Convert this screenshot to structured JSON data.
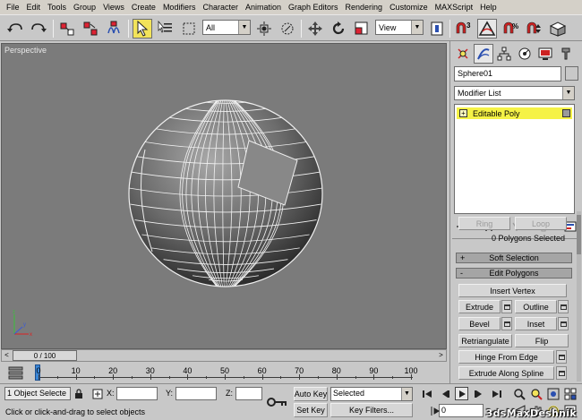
{
  "menu": [
    "File",
    "Edit",
    "Tools",
    "Group",
    "Views",
    "Create",
    "Modifiers",
    "Character",
    "Animation",
    "Graph Editors",
    "Rendering",
    "Customize",
    "MAXScript",
    "Help"
  ],
  "toolbar": {
    "selection_filter": "All",
    "reference_coord": "View",
    "icons": [
      "undo-icon",
      "redo-icon",
      "select-and-link-icon",
      "unlink-icon",
      "bind-space-warp-icon",
      "select-object-icon",
      "select-by-name-icon",
      "rectangular-selection-icon",
      "window-crossing-icon",
      "select-and-move-icon",
      "select-and-rotate-icon",
      "select-and-scale-icon",
      "use-pivot-center-icon",
      "select-and-manipulate-icon",
      "snaps-toggle-icon",
      "angle-snap-icon",
      "percent-snap-icon",
      "spinner-snap-icon",
      "named-selection-icon"
    ]
  },
  "viewport": {
    "label": "Perspective",
    "background": "#7b7b7b",
    "axes": {
      "x": "x",
      "y": "y",
      "z": "z"
    }
  },
  "timeslider": {
    "label": "0 / 100",
    "current_frame": 0,
    "total_frames": 100
  },
  "trackbar": {
    "ticks": [
      "0",
      "10",
      "20",
      "30",
      "40",
      "50",
      "60",
      "70",
      "80",
      "90",
      "100"
    ]
  },
  "command_panel": {
    "active_tab": "modify",
    "tabs": [
      "create-tab-icon",
      "modify-tab-icon",
      "hierarchy-tab-icon",
      "motion-tab-icon",
      "display-tab-icon",
      "utilities-tab-icon"
    ],
    "object_name": "Sphere01",
    "modifier_list": "Modifier List",
    "stack_items": [
      {
        "label": "Editable Poly",
        "selected": true
      }
    ],
    "selection": {
      "ring_label": "Ring",
      "loop_label": "Loop",
      "status": "0 Polygons Selected"
    },
    "soft_selection": {
      "sign": "+",
      "label": "Soft Selection"
    },
    "edit_polygons": {
      "sign": "-",
      "label": "Edit Polygons",
      "insert_vertex": "Insert Vertex",
      "extrude": "Extrude",
      "outline": "Outline",
      "bevel": "Bevel",
      "inset": "Inset",
      "retriangulate": "Retriangulate",
      "flip": "Flip",
      "hinge_from_edge": "Hinge From Edge",
      "extrude_along_spline": "Extrude Along Spline"
    }
  },
  "status_bar": {
    "selection": "1 Object Selecte",
    "prompt": "Click or click-and-drag to select objects",
    "x_label": "X:",
    "y_label": "Y:",
    "z_label": "Z:",
    "x_value": "",
    "y_value": "",
    "z_value": "",
    "auto_key": "Auto Key",
    "set_key": "Set Key",
    "key_mode": "Selected",
    "key_filters": "Key Filters...",
    "frame": "0",
    "watermark": "3dsMaxDeshnik"
  }
}
